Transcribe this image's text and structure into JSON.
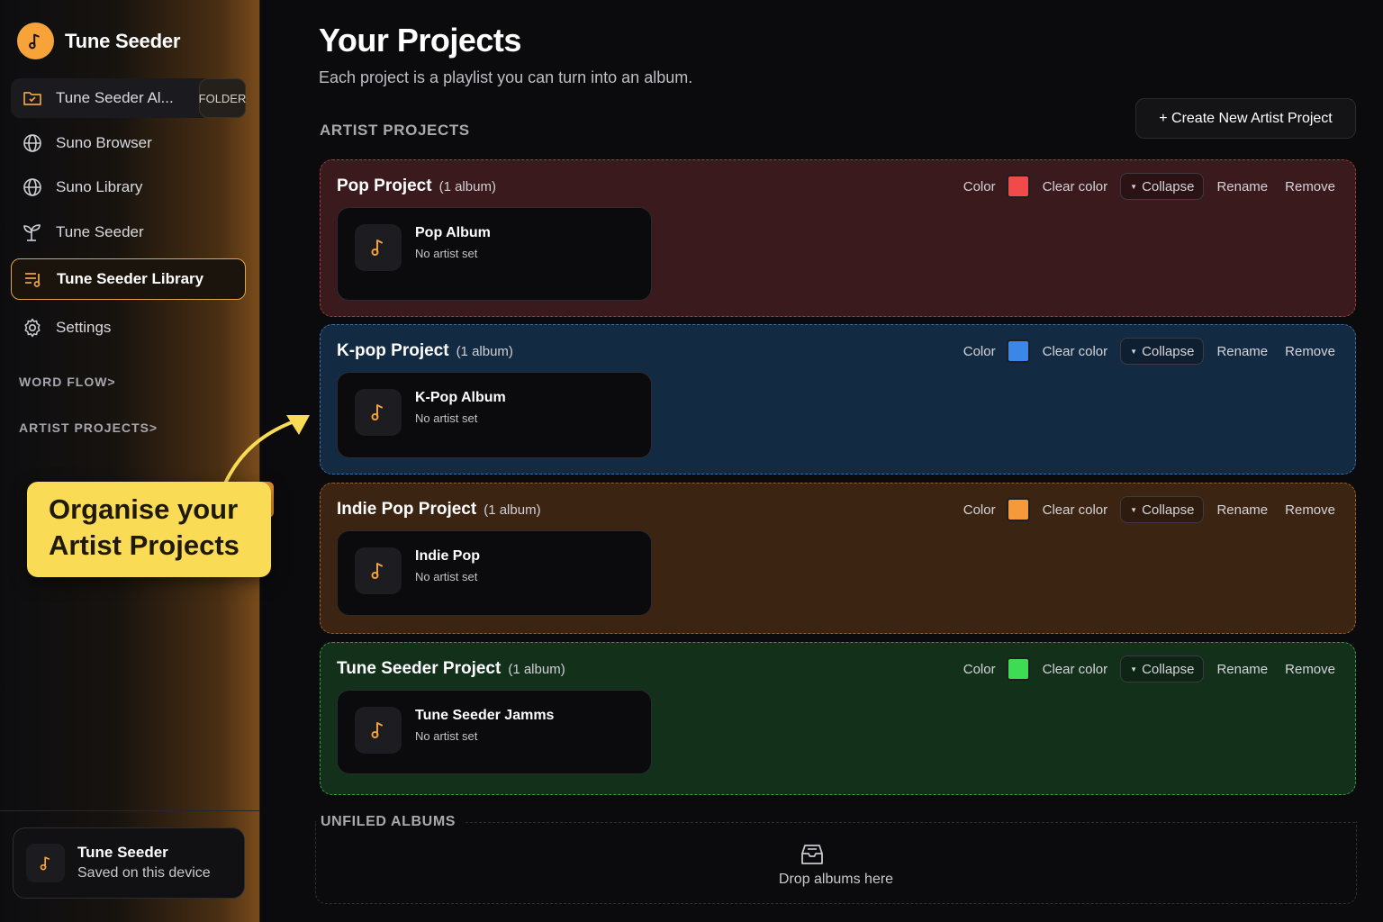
{
  "app": {
    "name": "Tune Seeder"
  },
  "sidebar": {
    "items": [
      {
        "label": "Tune Seeder Al...",
        "badge": "FOLDER",
        "icon": "folder-icon"
      },
      {
        "label": "Suno Browser",
        "icon": "globe-icon"
      },
      {
        "label": "Suno Library",
        "icon": "globe-icon"
      },
      {
        "label": "Tune Seeder",
        "icon": "sprout-icon"
      },
      {
        "label": "Tune Seeder Library",
        "icon": "playlist-icon",
        "active": true
      },
      {
        "label": "Settings",
        "icon": "gear-icon"
      }
    ],
    "sections": [
      {
        "label": "WORD FLOW>"
      },
      {
        "label": "ARTIST PROJECTS>"
      }
    ],
    "footer": {
      "title": "Tune Seeder",
      "subtitle": "Saved on this device"
    }
  },
  "callout": {
    "line1": "Organise your",
    "line2": "Artist Projects"
  },
  "main": {
    "title": "Your Projects",
    "subtitle": "Each project is a playlist you can turn into an album.",
    "section_title": "ARTIST PROJECTS",
    "create_button": "+ Create New Artist Project",
    "controls": {
      "color": "Color",
      "clear": "Clear color",
      "collapse": "Collapse",
      "rename": "Rename",
      "remove": "Remove"
    },
    "projects": [
      {
        "name": "Pop Project",
        "count": "(1 album)",
        "color": "#f04a4a",
        "album": {
          "title": "Pop Album",
          "artist": "No artist set"
        }
      },
      {
        "name": "K-pop Project",
        "count": "(1 album)",
        "color": "#3b86e6",
        "album": {
          "title": "K-Pop Album",
          "artist": "No artist set"
        }
      },
      {
        "name": "Indie Pop Project",
        "count": "(1 album)",
        "color": "#f59a3a",
        "album": {
          "title": "Indie Pop",
          "artist": "No artist set"
        }
      },
      {
        "name": "Tune Seeder Project",
        "count": "(1 album)",
        "color": "#3ddc54",
        "album": {
          "title": "Tune Seeder Jamms",
          "artist": "No artist set"
        }
      }
    ],
    "unfiled": {
      "title": "UNFILED ALBUMS",
      "drop_text": "Drop albums here"
    }
  },
  "colors": {
    "accent": "#f6a43a",
    "callout": "#fadb55"
  }
}
